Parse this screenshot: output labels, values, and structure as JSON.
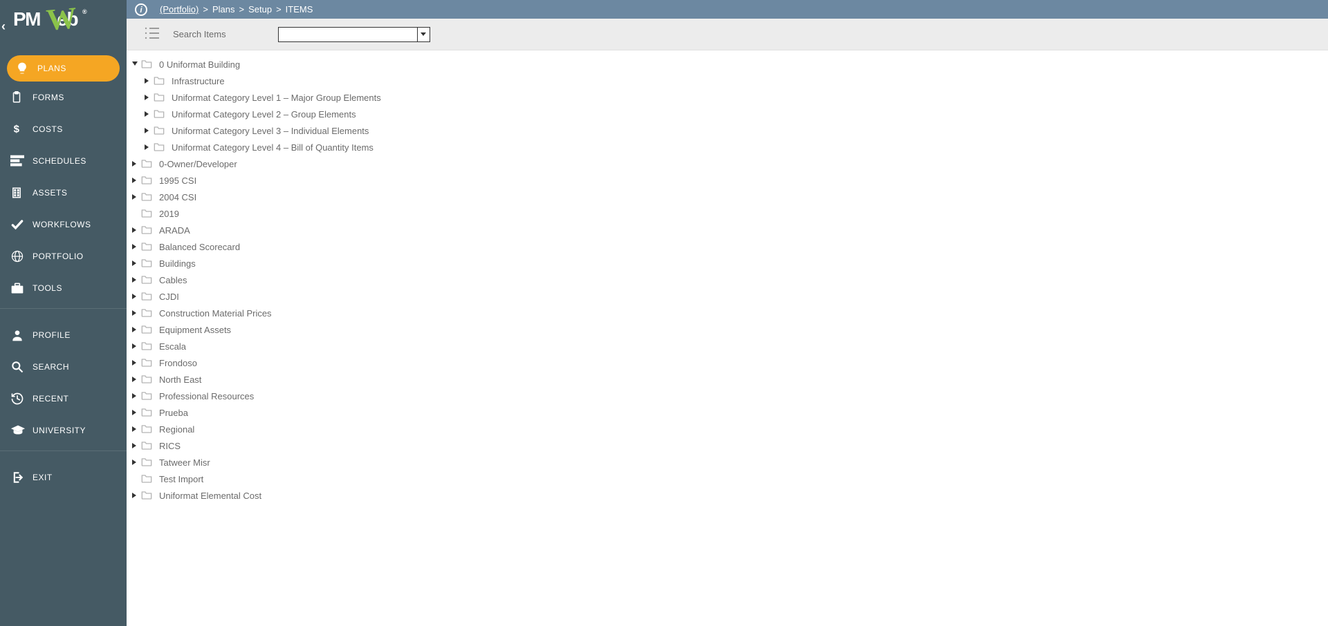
{
  "brand": {
    "text": "PMWeb",
    "reg": "®"
  },
  "nav": {
    "primary": [
      {
        "label": "PLANS",
        "icon": "bulb",
        "active": true
      },
      {
        "label": "FORMS",
        "icon": "clipboard",
        "active": false
      },
      {
        "label": "COSTS",
        "icon": "dollar",
        "active": false
      },
      {
        "label": "SCHEDULES",
        "icon": "bars-h",
        "active": false
      },
      {
        "label": "ASSETS",
        "icon": "building",
        "active": false
      },
      {
        "label": "WORKFLOWS",
        "icon": "check",
        "active": false
      },
      {
        "label": "PORTFOLIO",
        "icon": "globe",
        "active": false
      },
      {
        "label": "TOOLS",
        "icon": "briefcase",
        "active": false
      }
    ],
    "secondary": [
      {
        "label": "PROFILE",
        "icon": "person"
      },
      {
        "label": "SEARCH",
        "icon": "search"
      },
      {
        "label": "RECENT",
        "icon": "history"
      },
      {
        "label": "UNIVERSITY",
        "icon": "gradcap"
      }
    ],
    "tertiary": [
      {
        "label": "EXIT",
        "icon": "exit"
      }
    ]
  },
  "breadcrumb": {
    "info": "i",
    "link": "(Portfolio)",
    "parts": [
      "Plans",
      "Setup",
      "ITEMS"
    ],
    "sep": ">"
  },
  "search": {
    "label": "Search Items",
    "value": "",
    "placeholder": ""
  },
  "tree": [
    {
      "label": "0 Uniformat Building",
      "level": 0,
      "toggle": "expanded",
      "children": [
        {
          "label": "Infrastructure",
          "level": 1,
          "toggle": "collapsed"
        },
        {
          "label": "Uniformat Category Level 1 – Major Group Elements",
          "level": 1,
          "toggle": "collapsed"
        },
        {
          "label": "Uniformat Category Level 2 – Group Elements",
          "level": 1,
          "toggle": "collapsed"
        },
        {
          "label": "Uniformat Category Level 3 – Individual Elements",
          "level": 1,
          "toggle": "collapsed"
        },
        {
          "label": "Uniformat Category Level 4 – Bill of Quantity Items",
          "level": 1,
          "toggle": "collapsed"
        }
      ]
    },
    {
      "label": "0-Owner/Developer",
      "level": 0,
      "toggle": "collapsed"
    },
    {
      "label": "1995 CSI",
      "level": 0,
      "toggle": "collapsed"
    },
    {
      "label": "2004 CSI",
      "level": 0,
      "toggle": "collapsed"
    },
    {
      "label": "2019",
      "level": 0,
      "toggle": "none"
    },
    {
      "label": "ARADA",
      "level": 0,
      "toggle": "collapsed"
    },
    {
      "label": "Balanced Scorecard",
      "level": 0,
      "toggle": "collapsed"
    },
    {
      "label": "Buildings",
      "level": 0,
      "toggle": "collapsed"
    },
    {
      "label": "Cables",
      "level": 0,
      "toggle": "collapsed"
    },
    {
      "label": "CJDI",
      "level": 0,
      "toggle": "collapsed"
    },
    {
      "label": "Construction Material Prices",
      "level": 0,
      "toggle": "collapsed"
    },
    {
      "label": "Equipment Assets",
      "level": 0,
      "toggle": "collapsed"
    },
    {
      "label": "Escala",
      "level": 0,
      "toggle": "collapsed"
    },
    {
      "label": "Frondoso",
      "level": 0,
      "toggle": "collapsed"
    },
    {
      "label": "North East",
      "level": 0,
      "toggle": "collapsed"
    },
    {
      "label": "Professional Resources",
      "level": 0,
      "toggle": "collapsed"
    },
    {
      "label": "Prueba",
      "level": 0,
      "toggle": "collapsed"
    },
    {
      "label": "Regional",
      "level": 0,
      "toggle": "collapsed"
    },
    {
      "label": "RICS",
      "level": 0,
      "toggle": "collapsed"
    },
    {
      "label": "Tatweer Misr",
      "level": 0,
      "toggle": "collapsed"
    },
    {
      "label": "Test Import",
      "level": 0,
      "toggle": "none"
    },
    {
      "label": "Uniformat Elemental Cost",
      "level": 0,
      "toggle": "collapsed"
    }
  ]
}
